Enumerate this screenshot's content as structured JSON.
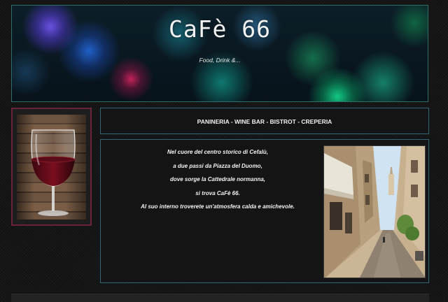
{
  "header": {
    "title": "CaFè 66",
    "tagline": "Food, Drink &..."
  },
  "services": {
    "text": "PANINERIA - WINE BAR - BISTROT - CREPERIA"
  },
  "intro": {
    "lines": [
      "Nel cuore del centro storico di Cefalù,",
      "a due passi da Piazza del Duomo,",
      "dove sorge la Cattedrale normanna,",
      "si trova CaFè 66.",
      "Al suo interno troverete un'atmosfera calda e amichevole."
    ]
  },
  "colors": {
    "page_background": "#151515",
    "header_border": "#2f6f6a",
    "panel_border": "#2e6675",
    "side_image_border": "#6a2238",
    "text": "#f0f0f0"
  }
}
